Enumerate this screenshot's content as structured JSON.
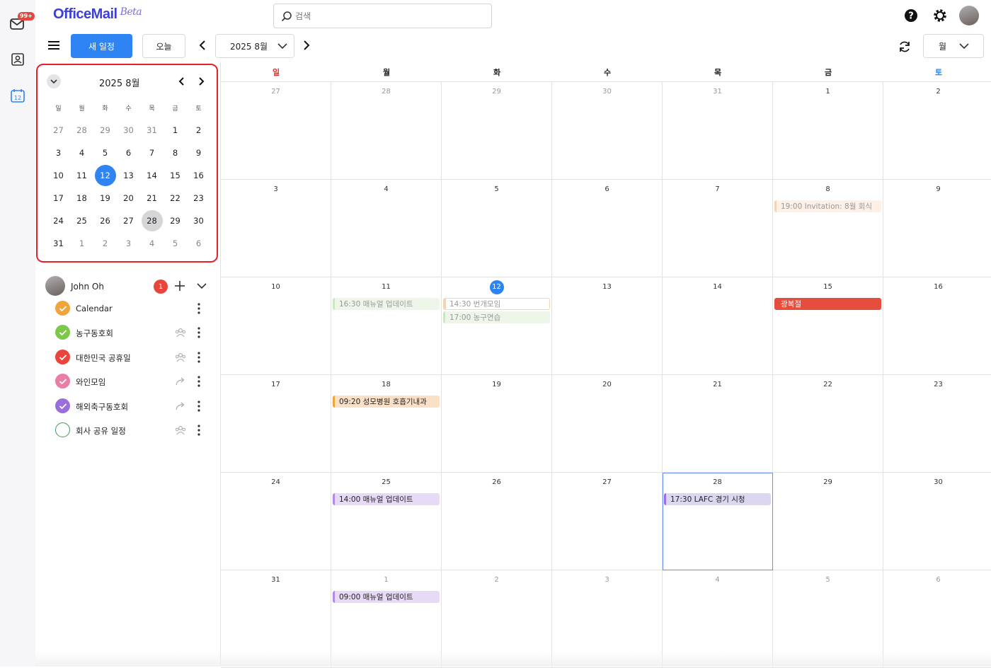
{
  "app": {
    "name": "OfficeMail",
    "tag": "Beta"
  },
  "rail": {
    "mail_badge": "99+"
  },
  "search": {
    "placeholder": "검색"
  },
  "toolbar": {
    "new_label": "새 일정",
    "today_label": "오늘",
    "month_label": "2025 8월",
    "view_label": "월"
  },
  "mini": {
    "title": "2025 8월",
    "dow": [
      "일",
      "월",
      "화",
      "수",
      "목",
      "금",
      "토"
    ],
    "weeks": [
      [
        {
          "d": "27",
          "out": true
        },
        {
          "d": "28",
          "out": true
        },
        {
          "d": "29",
          "out": true
        },
        {
          "d": "30",
          "out": true
        },
        {
          "d": "31",
          "out": true
        },
        {
          "d": "1"
        },
        {
          "d": "2"
        }
      ],
      [
        {
          "d": "3"
        },
        {
          "d": "4"
        },
        {
          "d": "5"
        },
        {
          "d": "6"
        },
        {
          "d": "7"
        },
        {
          "d": "8"
        },
        {
          "d": "9"
        }
      ],
      [
        {
          "d": "10"
        },
        {
          "d": "11"
        },
        {
          "d": "12",
          "today": true
        },
        {
          "d": "13"
        },
        {
          "d": "14"
        },
        {
          "d": "15"
        },
        {
          "d": "16"
        }
      ],
      [
        {
          "d": "17"
        },
        {
          "d": "18"
        },
        {
          "d": "19"
        },
        {
          "d": "20"
        },
        {
          "d": "21"
        },
        {
          "d": "22"
        },
        {
          "d": "23"
        }
      ],
      [
        {
          "d": "24"
        },
        {
          "d": "25"
        },
        {
          "d": "26"
        },
        {
          "d": "27"
        },
        {
          "d": "28",
          "sel": true
        },
        {
          "d": "29"
        },
        {
          "d": "30"
        }
      ],
      [
        {
          "d": "31"
        },
        {
          "d": "1",
          "out": true
        },
        {
          "d": "2",
          "out": true
        },
        {
          "d": "3",
          "out": true
        },
        {
          "d": "4",
          "out": true
        },
        {
          "d": "5",
          "out": true
        },
        {
          "d": "6",
          "out": true
        }
      ]
    ]
  },
  "owner": {
    "name": "John Oh",
    "badge": "1"
  },
  "calendars": [
    {
      "name": "Calendar",
      "color": "#f0a43a",
      "checked": true,
      "share": ""
    },
    {
      "name": "농구동호회",
      "color": "#7cc94a",
      "checked": true,
      "share": "group-icon"
    },
    {
      "name": "대한민국 공휴일",
      "color": "#e8453c",
      "checked": true,
      "share": "group-icon"
    },
    {
      "name": "와인모임",
      "color": "#e97fa6",
      "checked": true,
      "share": "share-icon"
    },
    {
      "name": "해외축구동호회",
      "color": "#9a6fdd",
      "checked": true,
      "share": "share-icon"
    },
    {
      "name": "회사 공유 일정",
      "color": "#3f9a5a",
      "checked": false,
      "share": "group-icon"
    }
  ],
  "month": {
    "dow": [
      "일",
      "월",
      "화",
      "수",
      "목",
      "금",
      "토"
    ],
    "weeks": [
      [
        {
          "d": "27",
          "out": true
        },
        {
          "d": "28",
          "out": true
        },
        {
          "d": "29",
          "out": true
        },
        {
          "d": "30",
          "out": true
        },
        {
          "d": "31",
          "out": true
        },
        {
          "d": "1"
        },
        {
          "d": "2"
        }
      ],
      [
        {
          "d": "3"
        },
        {
          "d": "4"
        },
        {
          "d": "5"
        },
        {
          "d": "6"
        },
        {
          "d": "7"
        },
        {
          "d": "8",
          "events": [
            {
              "text": "19:00 Invitation: 8월 회식",
              "bg": "#fdf0e6",
              "bar": "#f6d3b3",
              "fg": "#999"
            }
          ]
        },
        {
          "d": "9"
        }
      ],
      [
        {
          "d": "10"
        },
        {
          "d": "11",
          "events": [
            {
              "text": "16:30 매뉴얼 업데이트",
              "bg": "#eef6ea",
              "bar": "#cde6c2",
              "fg": "#999"
            }
          ]
        },
        {
          "d": "12",
          "today": true,
          "events": [
            {
              "text": "14:30 번개모임",
              "bg": "#ffffff",
              "bar": "#f6d3b3",
              "fg": "#999",
              "outline": "#f6d3b3"
            },
            {
              "text": "17:00 농구연습",
              "bg": "#eef6ea",
              "bar": "#cde6c2",
              "fg": "#999"
            }
          ]
        },
        {
          "d": "13"
        },
        {
          "d": "14"
        },
        {
          "d": "15",
          "events": [
            {
              "text": "광복절",
              "bg": "#e54d3d",
              "bar": "#e54d3d",
              "fg": "#ffffff"
            }
          ]
        },
        {
          "d": "16"
        }
      ],
      [
        {
          "d": "17"
        },
        {
          "d": "18",
          "events": [
            {
              "text": "09:20 성모병원 호흡기내과",
              "bg": "#fbe0c8",
              "bar": "#f0a43a",
              "fg": "#222"
            }
          ]
        },
        {
          "d": "19"
        },
        {
          "d": "20"
        },
        {
          "d": "21"
        },
        {
          "d": "22"
        },
        {
          "d": "23"
        }
      ],
      [
        {
          "d": "24"
        },
        {
          "d": "25",
          "events": [
            {
              "text": "14:00 매뉴얼 업데이트",
              "bg": "#e7daf6",
              "bar": "#b08ae6",
              "fg": "#222"
            }
          ]
        },
        {
          "d": "26"
        },
        {
          "d": "27"
        },
        {
          "d": "28",
          "hl": true,
          "events": [
            {
              "text": "17:30 LAFC 경기 시청",
              "bg": "#ddd6f0",
              "bar": "#9a6fdd",
              "fg": "#222"
            }
          ]
        },
        {
          "d": "29"
        },
        {
          "d": "30"
        }
      ],
      [
        {
          "d": "31"
        },
        {
          "d": "1",
          "out": true,
          "events": [
            {
              "text": "09:00 매뉴얼 업데이트",
              "bg": "#e7daf6",
              "bar": "#b08ae6",
              "fg": "#222"
            }
          ]
        },
        {
          "d": "2",
          "out": true
        },
        {
          "d": "3",
          "out": true
        },
        {
          "d": "4",
          "out": true
        },
        {
          "d": "5",
          "out": true
        },
        {
          "d": "6",
          "out": true
        }
      ]
    ]
  }
}
